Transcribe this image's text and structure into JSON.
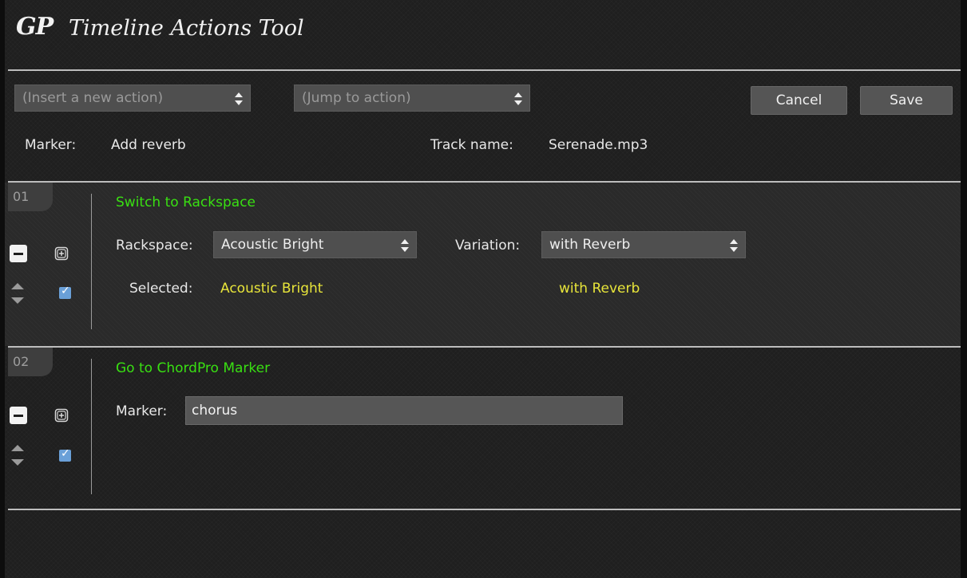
{
  "header": {
    "logo": "GP",
    "title": "Timeline Actions Tool"
  },
  "toolbar": {
    "insert_action_placeholder": "(Insert a new action)",
    "jump_to_action_placeholder": "(Jump to action)",
    "cancel_label": "Cancel",
    "save_label": "Save"
  },
  "info": {
    "marker_label": "Marker:",
    "marker_value": "Add reverb",
    "track_name_label": "Track name:",
    "track_name_value": "Serenade.mp3"
  },
  "actions": [
    {
      "number": "01",
      "type": "Switch to Rackspace",
      "rackspace_label": "Rackspace:",
      "rackspace_value": "Acoustic Bright",
      "variation_label": "Variation:",
      "variation_value": "with Reverb",
      "selected_label": "Selected:",
      "selected_rackspace": "Acoustic Bright",
      "selected_variation": "with Reverb",
      "enabled": true
    },
    {
      "number": "02",
      "type": "Go to ChordPro Marker",
      "marker_label": "Marker:",
      "marker_value": "chorus",
      "enabled": true
    }
  ],
  "colors": {
    "action_type": "#39e012",
    "selected_value": "#e8e53a",
    "checkbox": "#6aa0d8"
  },
  "icons": {
    "select_arrows": "updown-icon",
    "remove": "minus-icon",
    "duplicate": "duplicate-icon",
    "reorder": "reorder-icon",
    "enabled": "checkbox-icon"
  }
}
